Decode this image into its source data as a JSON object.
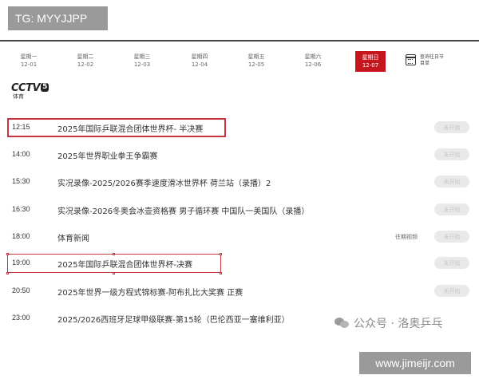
{
  "watermarks": {
    "tg_label": "TG: MYYJJPP",
    "wechat": "公众号 · 洛奥乒乓",
    "url": "www.jimeijr.com"
  },
  "day_tabs": [
    {
      "weekday": "星期一",
      "date": "12-01",
      "active": false
    },
    {
      "weekday": "星期二",
      "date": "12-02",
      "active": false
    },
    {
      "weekday": "星期三",
      "date": "12-03",
      "active": false
    },
    {
      "weekday": "星期四",
      "date": "12-04",
      "active": false
    },
    {
      "weekday": "星期五",
      "date": "12-05",
      "active": false
    },
    {
      "weekday": "星期六",
      "date": "12-06",
      "active": false
    },
    {
      "weekday": "星期日",
      "date": "12-07",
      "active": true
    }
  ],
  "calendar": {
    "icon": "calendar-icon",
    "label_line1": "查询往日节",
    "label_line2": "目单"
  },
  "channel": {
    "brand": "CCTV",
    "number": "5",
    "sub": "体育"
  },
  "schedule": [
    {
      "time": "12:15",
      "title": "2025年国际乒联混合团体世界杯- 半决赛",
      "replay": "",
      "status": "未开始",
      "highlighted": true
    },
    {
      "time": "14:00",
      "title": "2025年世界职业拳王争霸赛",
      "replay": "",
      "status": "未开始",
      "highlighted": false
    },
    {
      "time": "15:30",
      "title": "实况录像-2025/2026赛季速度滑冰世界杯 荷兰站（录播）2",
      "replay": "",
      "status": "未开始",
      "highlighted": false
    },
    {
      "time": "16:30",
      "title": "实况录像-2026冬奥会冰壶资格赛 男子循环赛 中国队一美国队（录播）",
      "replay": "",
      "status": "未开始",
      "highlighted": false
    },
    {
      "time": "18:00",
      "title": "体育新闻",
      "replay": "往期视频",
      "status": "未开始",
      "highlighted": false
    },
    {
      "time": "19:00",
      "title": "2025年国际乒联混合团体世界杯-决赛",
      "replay": "",
      "status": "未开始",
      "highlighted": true
    },
    {
      "time": "20:50",
      "title": "2025年世界一级方程式锦标赛-阿布扎比大奖赛 正赛",
      "replay": "",
      "status": "未开始",
      "highlighted": false
    },
    {
      "time": "23:00",
      "title": "2025/2026西班牙足球甲级联赛-第15轮（巴伦西亚一塞维利亚）",
      "replay": "",
      "status": "",
      "highlighted": false
    }
  ],
  "colors": {
    "accent": "#c4161c",
    "highlight_box": "#c8353f",
    "status_bg": "#e9e9e9",
    "status_text": "#c7c7c7"
  }
}
